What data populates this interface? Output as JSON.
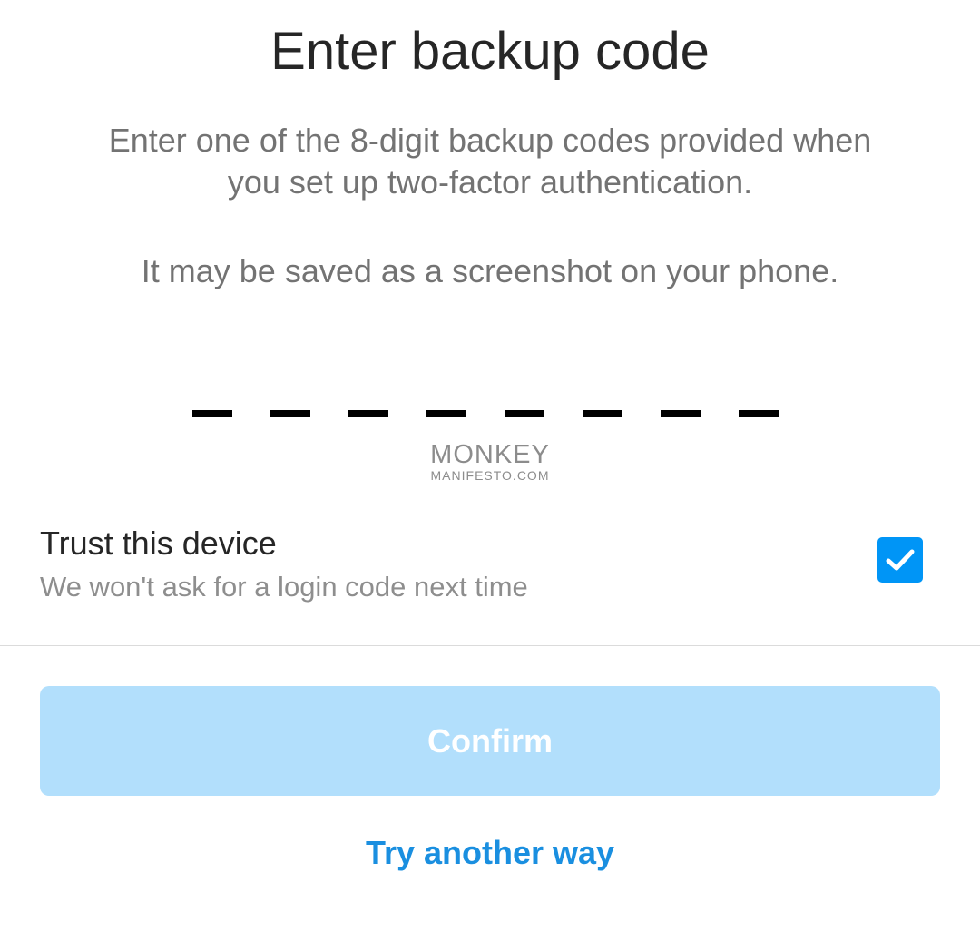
{
  "header": {
    "title": "Enter backup code"
  },
  "instructions": {
    "line1": "Enter one of the 8-digit backup codes provided when",
    "line2": "you set up two-factor authentication.",
    "hint": "It may be saved as a screenshot on your phone."
  },
  "code_input": {
    "digit_count": 8,
    "value": ""
  },
  "watermark": {
    "line1": "MONKEY",
    "line2": "MANIFESTO.COM"
  },
  "trust_device": {
    "title": "Trust this device",
    "subtitle": "We won't ask for a login code next time",
    "checked": true,
    "checkbox_icon": "checkmark-icon"
  },
  "actions": {
    "confirm_label": "Confirm",
    "confirm_enabled": false,
    "try_another_label": "Try another way"
  },
  "colors": {
    "accent": "#0095f6",
    "confirm_disabled_bg": "#b2dffc",
    "link": "#1a8fe0",
    "title_text": "#262626",
    "secondary_text": "#737373"
  }
}
